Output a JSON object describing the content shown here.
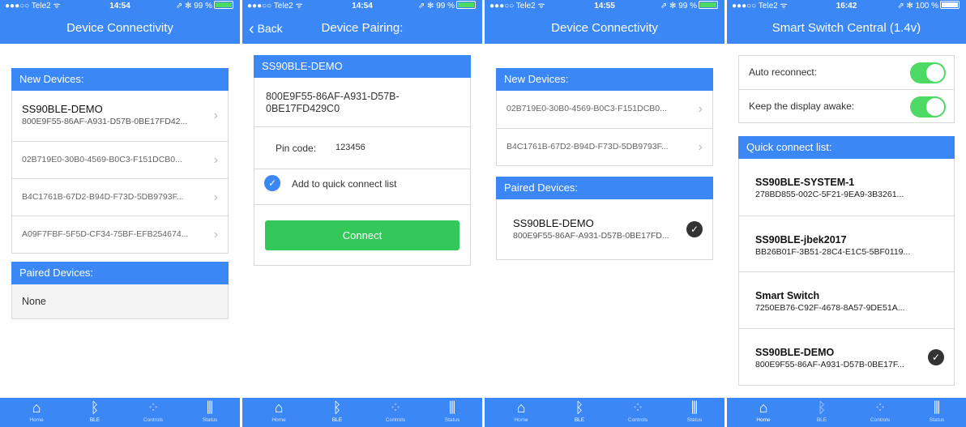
{
  "status": {
    "carrier": "●●●○○ Tele2 ᯤ",
    "s1": {
      "time": "14:54",
      "right": "⇗ ✻ 99 %"
    },
    "s2": {
      "time": "14:54",
      "right": "⇗ ✻ 99 %"
    },
    "s3": {
      "time": "14:55",
      "right": "⇗ ✻ 99 %"
    },
    "s4": {
      "time": "16:42",
      "right": "⇗ ✻ 100 %"
    }
  },
  "screen1": {
    "title": "Device Connectivity",
    "new_devices_label": "New Devices:",
    "new_devices": [
      {
        "name": "SS90BLE-DEMO",
        "uuid": "800E9F55-86AF-A931-D57B-0BE17FD42..."
      },
      {
        "uuid": "02B719E0-30B0-4569-B0C3-F151DCB0..."
      },
      {
        "uuid": "B4C1761B-67D2-B94D-F73D-5DB9793F..."
      },
      {
        "uuid": "A09F7FBF-5F5D-CF34-75BF-EFB254674..."
      }
    ],
    "paired_devices_label": "Paired Devices:",
    "paired_none": "None"
  },
  "screen2": {
    "back_label": "Back",
    "title": "Device Pairing:",
    "device_name": "SS90BLE-DEMO",
    "uuid": "800E9F55-86AF-A931-D57B-0BE17FD429C0",
    "pin_label": "Pin code:",
    "pin_value": "123456",
    "quick_connect_label": "Add to quick connect list",
    "connect_label": "Connect"
  },
  "screen3": {
    "title": "Device Connectivity",
    "new_devices_label": "New Devices:",
    "new_devices": [
      {
        "uuid": "02B719E0-30B0-4569-B0C3-F151DCB0..."
      },
      {
        "uuid": "B4C1761B-67D2-B94D-F73D-5DB9793F..."
      }
    ],
    "paired_devices_label": "Paired Devices:",
    "paired": [
      {
        "name": "SS90BLE-DEMO",
        "uuid": "800E9F55-86AF-A931-D57B-0BE17FD..."
      }
    ]
  },
  "screen4": {
    "title": "Smart Switch Central (1.4v)",
    "auto_reconnect_label": "Auto reconnect:",
    "keep_awake_label": "Keep the display awake:",
    "quick_list_label": "Quick connect list:",
    "quick_list": [
      {
        "name": "SS90BLE-SYSTEM-1",
        "uuid": "278BD855-002C-5F21-9EA9-3B3261..."
      },
      {
        "name": "SS90BLE-jbek2017",
        "uuid": "BB26B01F-3B51-28C4-E1C5-5BF0119..."
      },
      {
        "name": "Smart Switch",
        "uuid": "7250EB76-C92F-4678-8A57-9DE51A..."
      },
      {
        "name": "SS90BLE-DEMO",
        "uuid": "800E9F55-86AF-A931-D57B-0BE17F..."
      }
    ]
  },
  "tabs": [
    {
      "label": "Home",
      "icon": "home-icon"
    },
    {
      "label": "BLE",
      "icon": "bluetooth-icon"
    },
    {
      "label": "Controls",
      "icon": "controls-icon"
    },
    {
      "label": "Status",
      "icon": "status-icon"
    }
  ],
  "colors": {
    "accent": "#3b87f5",
    "connect": "#34c759",
    "toggle_on": "#4cd964"
  }
}
